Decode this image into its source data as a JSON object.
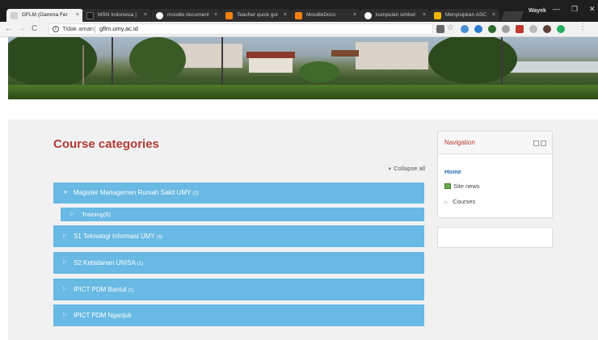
{
  "browser": {
    "tabs": [
      {
        "title": "GFLM (Gamma Fer",
        "favicon_color": "#d0d0d0",
        "active": true
      },
      {
        "title": "MSN Indonesia | E",
        "favicon_color": "#1a1a1a",
        "active": false
      },
      {
        "title": "moodle document",
        "favicon_color": "#ffffff",
        "active": false
      },
      {
        "title": "Teacher quick guid",
        "favicon_color": "#f98012",
        "active": false
      },
      {
        "title": "MoodleDocs",
        "favicon_color": "#f98012",
        "active": false
      },
      {
        "title": "kumpulan simbol",
        "favicon_color": "#ffffff",
        "active": false
      },
      {
        "title": "Menyisipkan ASCI",
        "favicon_color": "#f4b400",
        "active": false
      }
    ],
    "tab_close_glyph": "×",
    "profile_name": "Wayek",
    "window_controls": {
      "minimize": "—",
      "maximize": "❐",
      "close": "✕"
    },
    "address": {
      "security_text": "Tidak aman",
      "url": "gflm.umy.ac.id"
    },
    "extension_colors": [
      "#d9534f",
      "#555555",
      "#4a90d9",
      "#2b7bd1",
      "#2d6a2d",
      "#9e9e9e",
      "#c0392b",
      "#999999",
      "#5d4037",
      "#27ae60"
    ]
  },
  "page": {
    "title": "Course categories",
    "collapse_all": "Collapse all",
    "accent_color": "#b23a35",
    "category_color": "#68b9e3",
    "categories": [
      {
        "name": "Magister Managemen Rumah Sakit UMY",
        "count": "(2)",
        "expanded": true,
        "children": [
          {
            "name": "Training",
            "count": "(6)"
          }
        ]
      },
      {
        "name": "S1 Teknologi Informasi UMY",
        "count": "(4)",
        "expanded": false
      },
      {
        "name": "S2 Kebidanan UNISA",
        "count": "(1)",
        "expanded": false
      },
      {
        "name": "IPICT PDM Bantul",
        "count": "(1)",
        "expanded": false
      },
      {
        "name": "IPICT PDM Nganjuk",
        "count": "",
        "expanded": false
      }
    ]
  },
  "navigation": {
    "title": "Navigation",
    "home": "Home",
    "site_news": "Site news",
    "courses": "Courses"
  }
}
